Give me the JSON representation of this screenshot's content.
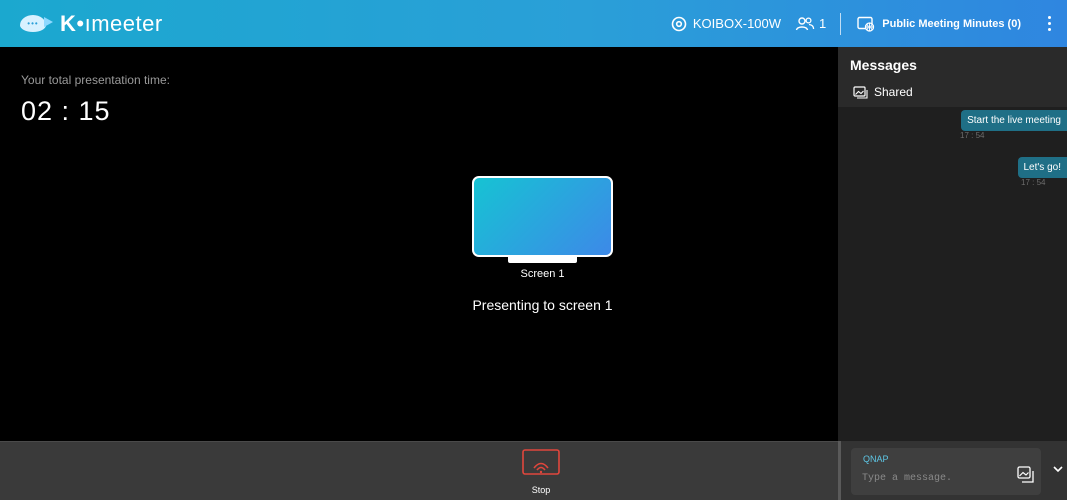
{
  "header": {
    "logo_prefix": "K",
    "logo_bold_mid": "•ı",
    "logo_suffix": "meeter",
    "location": "KOIBOX-100W",
    "user_count": "1",
    "meeting_minutes": "Public Meeting Minutes (0)",
    "location_icon": "location-pin-icon",
    "users_icon": "users-icon",
    "minutes_icon": "meeting-minutes-icon",
    "menu_icon": "more-vertical-icon"
  },
  "stage": {
    "presentation_time_label": "Your total presentation time:",
    "presentation_time": "02 : 15",
    "screen_label": "Screen 1",
    "status": "Presenting to screen 1"
  },
  "messages": {
    "title": "Messages",
    "shared_label": "Shared",
    "items": [
      {
        "text": "Start the live meeting",
        "time": "17 : 54"
      },
      {
        "text": "Let's go!",
        "time": "17 : 54"
      }
    ]
  },
  "controls": {
    "stop_label": "Stop",
    "stop_icon": "stop-cast-icon",
    "stop_color": "#e0463c"
  },
  "composer": {
    "sender": "QNAP",
    "placeholder": "Type a message.",
    "image_icon": "image-attach-icon",
    "expand_icon": "chevron-down-icon"
  },
  "colors": {
    "header_start": "#1ba8cf",
    "header_end": "#2f86e0",
    "bubble": "#1f6f86",
    "accent": "#5ec7e6"
  }
}
